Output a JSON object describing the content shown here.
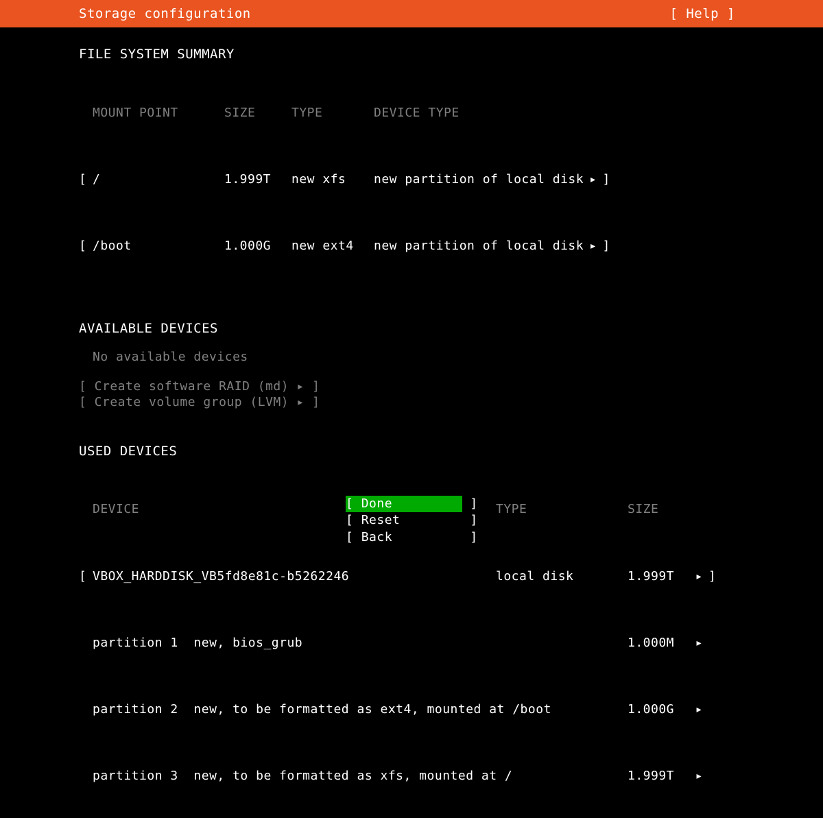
{
  "header": {
    "title": "Storage configuration",
    "help": "[ Help ]"
  },
  "fs_summary": {
    "heading": "FILE SYSTEM SUMMARY",
    "columns": {
      "mount": "MOUNT POINT",
      "size": "SIZE",
      "type": "TYPE",
      "device_type": "DEVICE TYPE"
    },
    "rows": [
      {
        "mount": "/",
        "size": "1.999T",
        "type": "new xfs",
        "device_type": "new partition of local disk"
      },
      {
        "mount": "/boot",
        "size": "1.000G",
        "type": "new ext4",
        "device_type": "new partition of local disk"
      }
    ]
  },
  "available": {
    "heading": "AVAILABLE DEVICES",
    "none": "No available devices",
    "create_raid": "[ Create software RAID (md) ▸ ]",
    "create_lvm": "[ Create volume group (LVM) ▸ ]"
  },
  "used": {
    "heading": "USED DEVICES",
    "columns": {
      "device": "DEVICE",
      "type": "TYPE",
      "size": "SIZE"
    },
    "disk": {
      "name": "VBOX_HARDDISK_VB5fd8e81c-b5262246",
      "type": "local disk",
      "size": "1.999T"
    },
    "partitions": [
      {
        "label": "partition 1",
        "desc": "new, bios_grub",
        "size": "1.000M"
      },
      {
        "label": "partition 2",
        "desc": "new, to be formatted as ext4, mounted at /boot",
        "size": "1.000G"
      },
      {
        "label": "partition 3",
        "desc": "new, to be formatted as xfs, mounted at /",
        "size": "1.999T"
      }
    ]
  },
  "footer": {
    "done": "Done",
    "reset": "Reset",
    "back": "Back"
  },
  "glyphs": {
    "triangle": "▸",
    "bracket_open": "[",
    "bracket_close": "]"
  }
}
